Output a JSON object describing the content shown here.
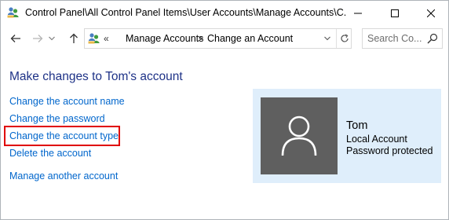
{
  "window": {
    "title": "Control Panel\\All Control Panel Items\\User Accounts\\Manage Accounts\\C...",
    "icon": "user-accounts-icon"
  },
  "navigation": {
    "chevron": "«",
    "breadcrumbs": [
      "Manage Accounts",
      "Change an Account"
    ],
    "separator": ">",
    "search_placeholder": "Search Co..."
  },
  "main": {
    "heading": "Make changes to Tom's account",
    "links": [
      "Change the account name",
      "Change the password",
      "Change the account type",
      "Delete the account",
      "Manage another account"
    ],
    "highlighted_link": "Change the account type"
  },
  "account": {
    "name": "Tom",
    "type": "Local Account",
    "status": "Password protected",
    "avatar_icon": "user-avatar-icon"
  },
  "colors": {
    "heading": "#1e3287",
    "link": "#0066cc",
    "highlight": "#e00000",
    "panel": "#dfeefb",
    "avatar_bg": "#5f5f5f"
  }
}
